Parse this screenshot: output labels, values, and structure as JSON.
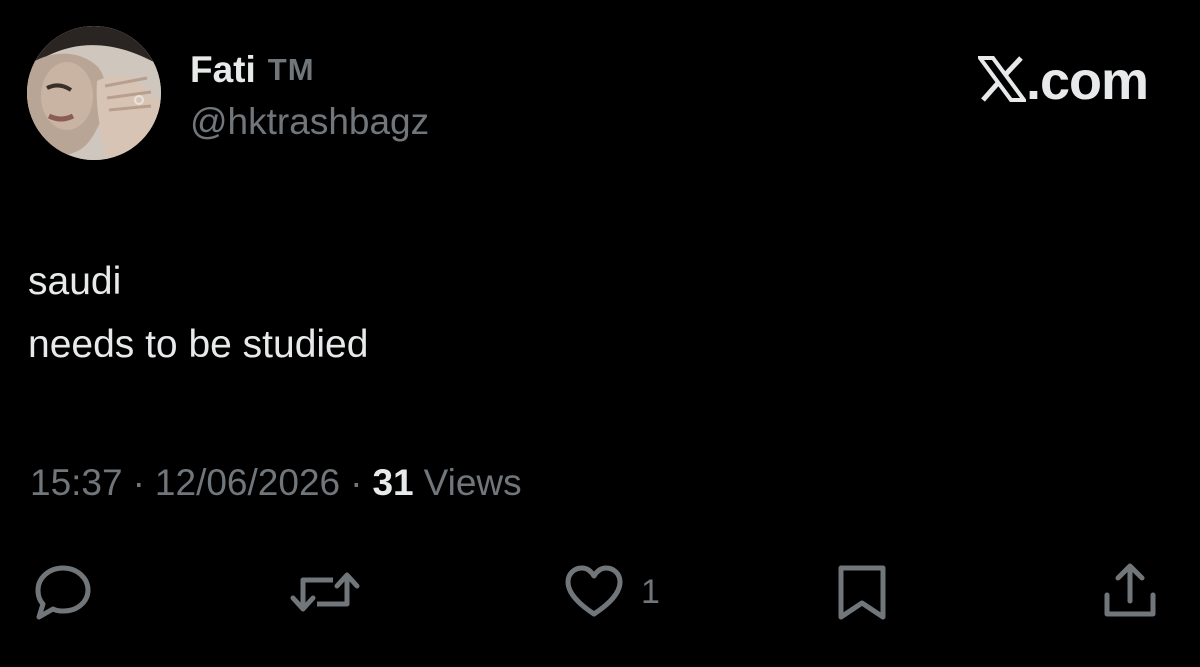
{
  "author": {
    "display_name": "Fati",
    "name_suffix": "TM",
    "handle": "@hktrashbagz",
    "avatar": "profile-photo"
  },
  "brand": {
    "icon": "x-logo-icon",
    "domain_suffix": ".com"
  },
  "tweet": {
    "lines": [
      "saudi",
      "needs to be studied"
    ]
  },
  "meta": {
    "time": "15:37",
    "separator": "·",
    "date": "12/06/2026",
    "views_count": "31",
    "views_label": "Views"
  },
  "actions": {
    "reply_icon": "reply-icon",
    "repost_icon": "repost-icon",
    "like_icon": "heart-icon",
    "like_count": "1",
    "bookmark_icon": "bookmark-icon",
    "share_icon": "share-icon"
  },
  "colors": {
    "background": "#000000",
    "primary_text": "#e7e9ea",
    "secondary_text": "#71767b"
  }
}
